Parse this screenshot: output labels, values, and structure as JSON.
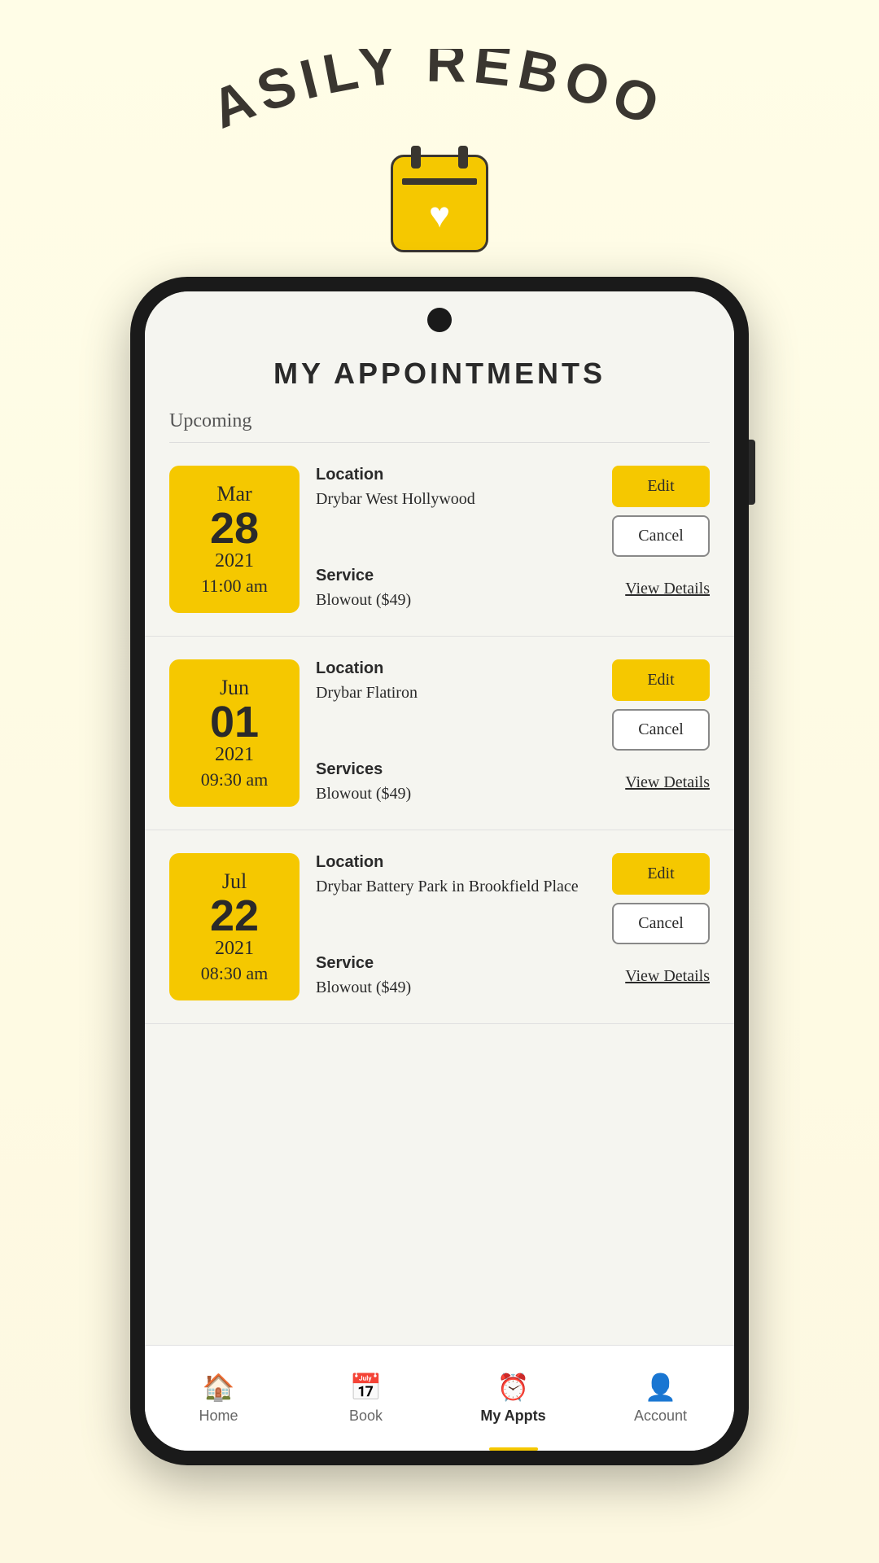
{
  "banner": {
    "title": "EASILY REBOOK",
    "calendar_icon_label": "calendar-heart-icon"
  },
  "screen": {
    "title": "MY APPOINTMENTS",
    "section_label": "Upcoming",
    "appointments": [
      {
        "id": "appt-1",
        "month": "Mar",
        "day": "28",
        "year": "2021",
        "time": "11:00 am",
        "location_label": "Location",
        "location": "Drybar West Hollywood",
        "service_label": "Service",
        "service": "Blowout ($49)",
        "edit_label": "Edit",
        "cancel_label": "Cancel",
        "view_details_label": "View Details"
      },
      {
        "id": "appt-2",
        "month": "Jun",
        "day": "01",
        "year": "2021",
        "time": "09:30 am",
        "location_label": "Location",
        "location": "Drybar Flatiron",
        "service_label": "Services",
        "service": "Blowout ($49)",
        "edit_label": "Edit",
        "cancel_label": "Cancel",
        "view_details_label": "View Details"
      },
      {
        "id": "appt-3",
        "month": "Jul",
        "day": "22",
        "year": "2021",
        "time": "08:30 am",
        "location_label": "Location",
        "location": "Drybar Battery Park in Brookfield Place",
        "service_label": "Service",
        "service": "Blowout ($49)",
        "edit_label": "Edit",
        "cancel_label": "Cancel",
        "view_details_label": "View Details"
      }
    ]
  },
  "nav": {
    "items": [
      {
        "id": "home",
        "label": "Home",
        "icon": "🏠",
        "active": false
      },
      {
        "id": "book",
        "label": "Book",
        "icon": "📅",
        "active": false
      },
      {
        "id": "my-appts",
        "label": "My Appts",
        "icon": "⏰",
        "active": true
      },
      {
        "id": "account",
        "label": "Account",
        "icon": "👤",
        "active": false
      }
    ]
  },
  "colors": {
    "yellow": "#f5c800",
    "dark": "#2a2a2a",
    "bg": "#f5f5f0"
  }
}
